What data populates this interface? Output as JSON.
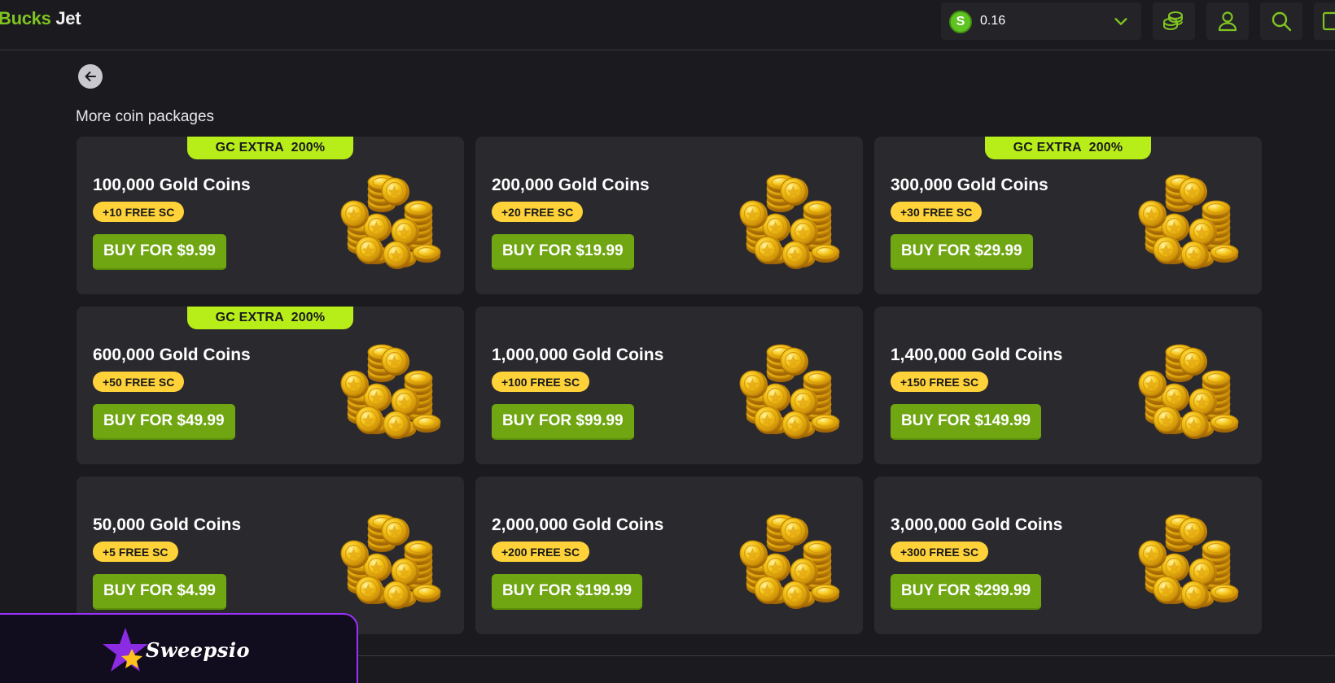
{
  "header": {
    "logo_part1": "Bucks",
    "logo_part2": "Jet",
    "balance": {
      "currency_symbol": "S",
      "amount": "0.16",
      "dropdown_icon": "chevron-down-icon"
    },
    "actions": [
      "coins-icon",
      "user-icon",
      "search-icon",
      "menu-icon"
    ]
  },
  "page": {
    "section_title": "More coin packages"
  },
  "colors": {
    "background": "#1b1a1e",
    "card": "#2a292e",
    "promo_lime": "#b7ee1a",
    "badge_gold": "#ffd23a",
    "buy_green": "#6fa612",
    "brand_green": "#7fc421"
  },
  "packages": [
    {
      "promo": "GC EXTRA  200%",
      "title": "100,000 Gold Coins",
      "bonus": "+10 FREE SC",
      "buy_label": "BUY FOR $9.99"
    },
    {
      "promo": "",
      "title": "200,000 Gold Coins",
      "bonus": "+20 FREE SC",
      "buy_label": "BUY FOR $19.99"
    },
    {
      "promo": "GC EXTRA  200%",
      "title": "300,000 Gold Coins",
      "bonus": "+30 FREE SC",
      "buy_label": "BUY FOR $29.99"
    },
    {
      "promo": "GC EXTRA  200%",
      "title": "600,000 Gold Coins",
      "bonus": "+50 FREE SC",
      "buy_label": "BUY FOR $49.99"
    },
    {
      "promo": "",
      "title": "1,000,000 Gold Coins",
      "bonus": "+100 FREE SC",
      "buy_label": "BUY FOR $99.99"
    },
    {
      "promo": "",
      "title": "1,400,000 Gold Coins",
      "bonus": "+150 FREE SC",
      "buy_label": "BUY FOR $149.99"
    },
    {
      "promo": "",
      "title": "50,000 Gold Coins",
      "bonus": "+5 FREE SC",
      "buy_label": "BUY FOR $4.99"
    },
    {
      "promo": "",
      "title": "2,000,000 Gold Coins",
      "bonus": "+200 FREE SC",
      "buy_label": "BUY FOR $199.99"
    },
    {
      "promo": "",
      "title": "3,000,000 Gold Coins",
      "bonus": "+300 FREE SC",
      "buy_label": "BUY FOR $299.99"
    }
  ],
  "watermark": {
    "text": "Sweepsio",
    "icon": "star-logo-icon"
  }
}
